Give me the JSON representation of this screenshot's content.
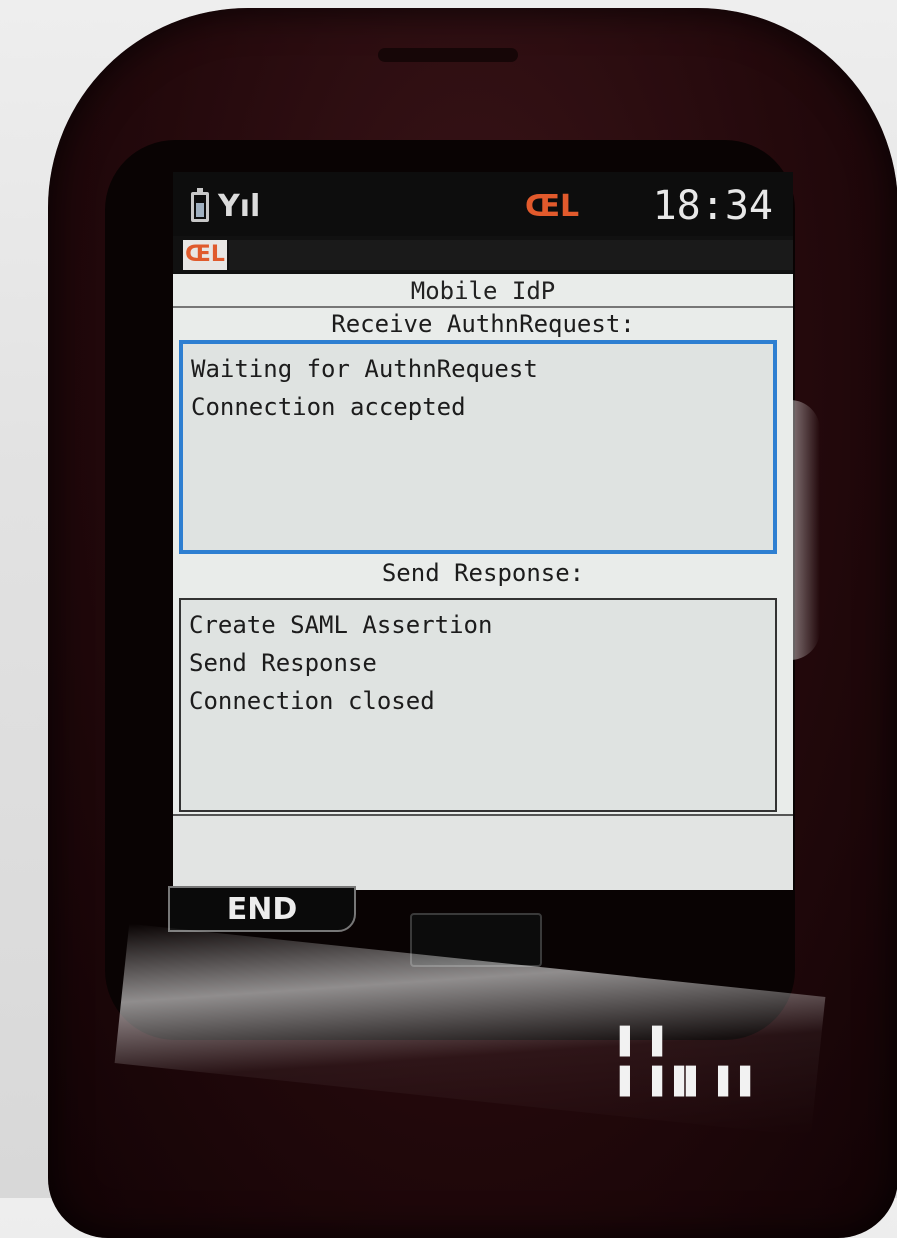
{
  "status_bar": {
    "battery_icon": "battery-icon",
    "signal_icon": "signal-icon",
    "signal_glyph": "Yıl",
    "app_icon": "app-indicator-icon",
    "app_glyph": "ŒL",
    "time": "18:34"
  },
  "app_bar": {
    "icon": "app-logo-icon",
    "icon_glyph": "ŒL"
  },
  "form": {
    "title": "Mobile IdP",
    "receive_label": "Receive AuthnRequest:",
    "receive_log": [
      "Waiting for AuthnRequest",
      "Connection accepted"
    ],
    "send_label": "Send Response:",
    "send_log": [
      "Create SAML Assertion",
      "Send Response",
      "Connection closed"
    ]
  },
  "softkeys": {
    "left_label": "END"
  }
}
